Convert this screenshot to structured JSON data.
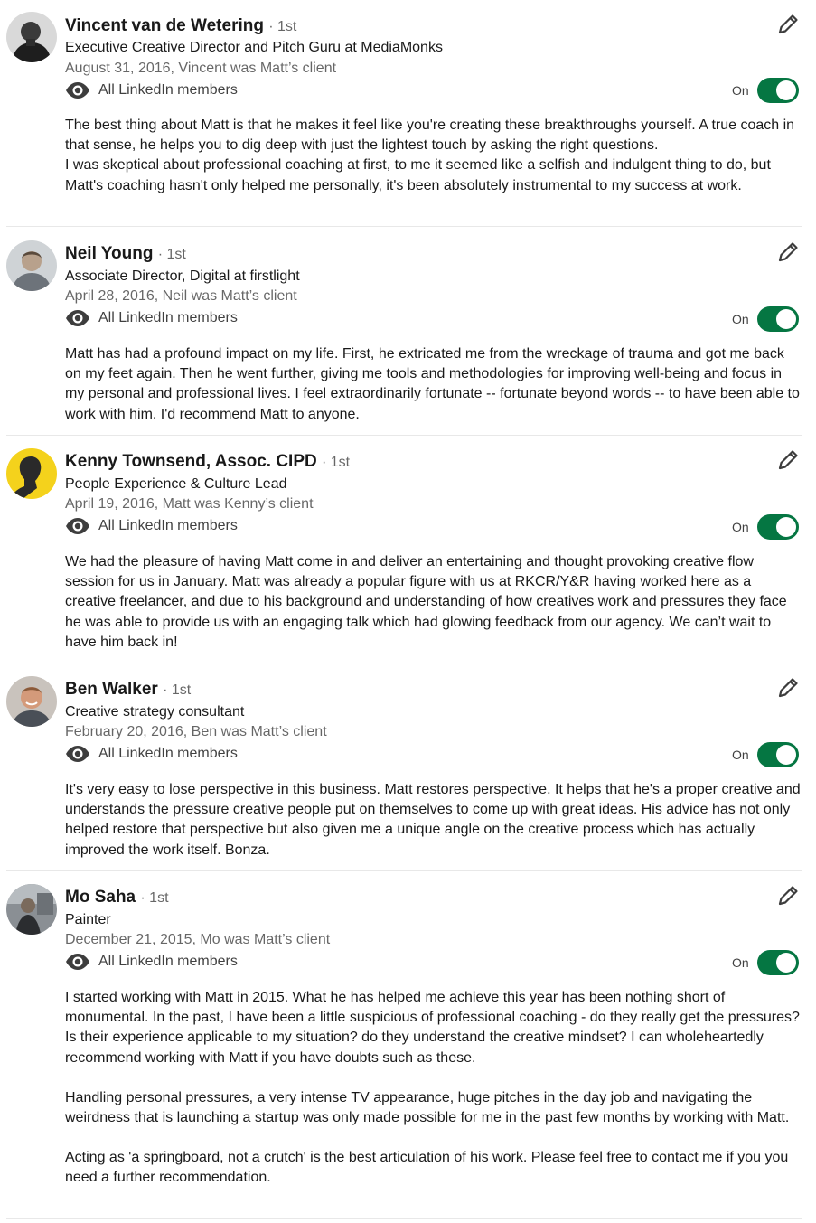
{
  "recommendations": [
    {
      "name": "Vincent van de Wetering",
      "degree": "· 1st",
      "headline": "Executive Creative Director and Pitch Guru at MediaMonks",
      "meta": "August 31, 2016, Vincent was Matt’s client",
      "visibility": "All LinkedIn members",
      "toggle_label": "On",
      "toggle_state": "on",
      "avatar": "dark-headshot",
      "paragraphs": [
        "The best thing about Matt is that he makes it feel like you're creating these breakthroughs yourself. A true coach in that sense, he helps you to dig deep with just the lightest touch by asking the right questions.",
        "I was skeptical about professional coaching at first, to me it seemed like a selfish and indulgent thing to do, but Matt's coaching hasn't only helped me personally, it's been absolutely instrumental to my success at work."
      ]
    },
    {
      "name": "Neil Young",
      "degree": "· 1st",
      "headline": "Associate Director, Digital at firstlight",
      "meta": "April 28, 2016, Neil was Matt’s client",
      "visibility": "All LinkedIn members",
      "toggle_label": "On",
      "toggle_state": "on",
      "avatar": "grey-headshot",
      "paragraphs": [
        "Matt has had a profound impact on my life. First, he extricated me from the wreckage of trauma and got me back on my feet again. Then he went further, giving me tools and methodologies for improving well-being and focus in my personal and professional lives. I feel extraordinarily fortunate -- fortunate beyond words -- to have been able to work with him. I'd recommend Matt to anyone."
      ]
    },
    {
      "name": "Kenny Townsend, Assoc. CIPD",
      "degree": "· 1st",
      "headline": "People Experience & Culture Lead",
      "meta": "April 19, 2016, Matt was Kenny’s client",
      "visibility": "All LinkedIn members",
      "toggle_label": "On",
      "toggle_state": "on",
      "avatar": "yellow-silhouette",
      "paragraphs": [
        "We had the pleasure of having Matt come in and deliver an entertaining and thought provoking creative flow session for us in January. Matt was already a popular figure with us at RKCR/Y&R having worked here as a creative freelancer, and due to his background and understanding of how creatives work and pressures they face he was able to provide us with an engaging talk which had glowing feedback from our agency. We can’t wait to have him back in!"
      ]
    },
    {
      "name": "Ben Walker",
      "degree": "· 1st",
      "headline": "Creative strategy consultant",
      "meta": "February 20, 2016, Ben was Matt’s client",
      "visibility": "All LinkedIn members",
      "toggle_label": "On",
      "toggle_state": "on",
      "avatar": "smiling-headshot",
      "paragraphs": [
        "It's very easy to lose perspective in this business. Matt restores perspective. It helps that he's a proper creative and understands the pressure creative people put on themselves to come up with great ideas. His advice has not only helped restore that perspective but also given me a unique angle on the creative process which has actually improved the work itself. Bonza."
      ]
    },
    {
      "name": "Mo Saha",
      "degree": "· 1st",
      "headline": "Painter",
      "meta": "December 21, 2015, Mo was Matt’s client",
      "visibility": "All LinkedIn members",
      "toggle_label": "On",
      "toggle_state": "on",
      "avatar": "studio-photo",
      "paragraphs": [
        "I started working with Matt in 2015. What he has helped me achieve this year has been nothing short of monumental. In the past, I have been a little suspicious of professional coaching - do they really get the pressures? Is their experience applicable to my situation? do they understand the creative mindset? I can wholeheartedly recommend working with Matt if you have doubts such as these.",
        "Handling personal pressures, a very intense TV appearance, huge pitches in the day job and navigating the weirdness that is launching a startup was only made possible for me in the past few months by working with Matt.",
        "Acting as 'a springboard, not a crutch' is the best articulation of his work. Please feel free to contact me if you you need a further recommendation."
      ]
    }
  ],
  "icons": {
    "visibility": "eye-icon",
    "edit": "pencil-icon"
  },
  "colors": {
    "toggle_on": "#057642",
    "primary_text": "#191919",
    "secondary_text": "#666666"
  }
}
